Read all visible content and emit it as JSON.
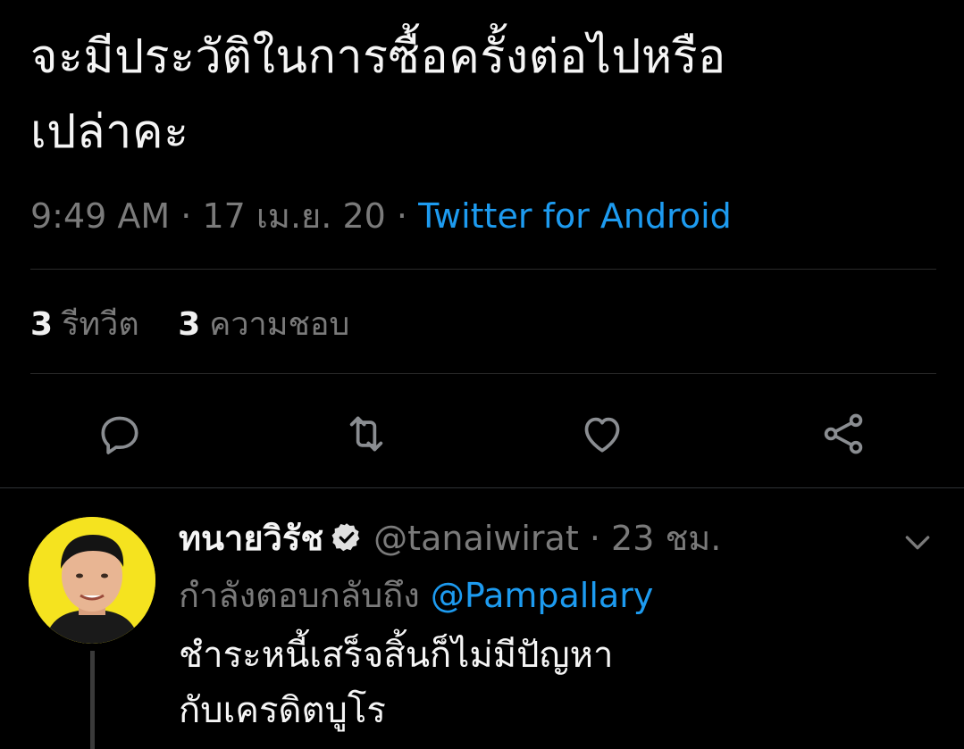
{
  "tweet": {
    "text_line1": "จะมีประวัติในการซื้อครั้งต่อไปหรือ",
    "text_line2": "เปล่าคะ",
    "time": "9:49 AM",
    "date": "17 เม.ย. 20",
    "separator": "·",
    "source": "Twitter for Android"
  },
  "stats": {
    "retweets_count": "3",
    "retweets_label": "รีทวีต",
    "likes_count": "3",
    "likes_label": "ความชอบ"
  },
  "actions": {
    "reply_icon": "comment-bubble-icon",
    "retweet_icon": "retweet-icon",
    "like_icon": "heart-icon",
    "share_icon": "share-icon"
  },
  "reply": {
    "name": "ทนายวิรัช",
    "verified": true,
    "handle": "@tanaiwirat",
    "separator": "·",
    "time_ago": "23 ชม.",
    "replying_label": "กำลังตอบกลับถึง",
    "replying_to": "@Pampallary",
    "text_line1": "ชำระหนี้เสร็จสิ้นก็ไม่มีปัญหา",
    "text_line2": "กับเครดิตบูโร"
  },
  "colors": {
    "background": "#000000",
    "accent": "#1d9bf0",
    "muted": "#7a7a7a",
    "avatar_bg": "#f5e31f"
  }
}
